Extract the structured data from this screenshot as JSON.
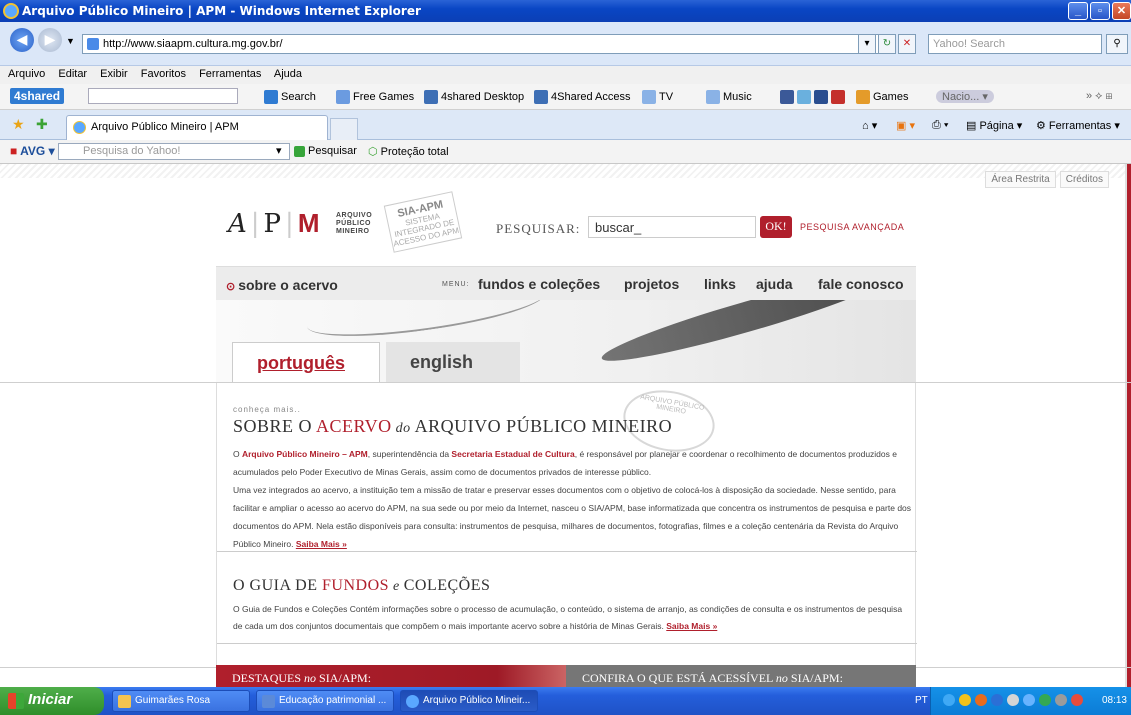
{
  "window": {
    "title": "Arquivo Público Mineiro | APM - Windows Internet Explorer"
  },
  "address": {
    "url": "http://www.siaapm.cultura.mg.gov.br/",
    "search_placeholder": "Yahoo! Search"
  },
  "menubar": {
    "items": [
      "Arquivo",
      "Editar",
      "Exibir",
      "Favoritos",
      "Ferramentas",
      "Ajuda"
    ]
  },
  "toolbar_4shared": {
    "logo": "4shared",
    "search_label": "Search",
    "items": [
      "Free Games",
      "4shared Desktop",
      "4Shared Access",
      "TV",
      "Music",
      "Games"
    ],
    "radio_label": "Nacio..."
  },
  "tabs": {
    "active": "Arquivo Público Mineiro | APM",
    "cmd_page": "Página",
    "cmd_tools": "Ferramentas"
  },
  "avg": {
    "logo": "AVG",
    "search_placeholder": "Pesquisa do Yahoo!",
    "search_btn": "Pesquisar",
    "protection": "Proteção total"
  },
  "site": {
    "toplinks": [
      "Área Restrita",
      "Créditos"
    ],
    "logo_text": [
      "ARQUIVO",
      "PÚBLICO",
      "MINEIRO"
    ],
    "sia_logo": {
      "title": "SIA-APM",
      "sub": "SISTEMA INTEGRADO DE ACESSO DO APM"
    },
    "search_label": "PESQUISAR:",
    "search_value": "buscar_",
    "ok_label": "OK!",
    "advanced": "PESQUISA AVANÇADA",
    "nav": {
      "sobre": "sobre o acervo",
      "menu_label": "MENU:",
      "links": [
        "fundos e coleções",
        "projetos",
        "links",
        "ajuda",
        "fale conosco"
      ]
    },
    "lang": {
      "pt": "português",
      "en": "english"
    },
    "conheca": "conheça mais..",
    "sobre_title": {
      "p1": "SOBRE O ",
      "p2": "ACERVO",
      "p3": " do ",
      "p4": "ARQUIVO PÚBLICO MINEIRO"
    },
    "stamp": "ARQUIVO PÚBLICO MINEIRO",
    "sobre_text": {
      "t1": "O ",
      "b1": "Arquivo Público Mineiro – APM",
      "t2": ", superintendência da ",
      "b2": "Secretaria Estadual de Cultura",
      "t3": ", é responsável por planejar e coordenar o recolhimento de documentos produzidos e acumulados pelo Poder Executivo de Minas Gerais, assim como de documentos privados de interesse público.",
      "t4": "Uma vez integrados ao acervo, a instituição tem a missão de tratar e preservar esses documentos com o objetivo de colocá-los à disposição da sociedade. Nesse sentido, para facilitar e ampliar o acesso ao acervo do APM, na sua sede ou por meio da Internet, nasceu o SIA/APM, base informatizada que concentra os instrumentos de pesquisa e parte dos documentos do APM. Nela estão disponíveis para consulta: instrumentos de pesquisa, milhares de documentos, fotografias, filmes e a coleção centenária da Revista do Arquivo Público Mineiro. ",
      "more": "Saiba Mais »"
    },
    "guia_title": {
      "p1": "O GUIA DE ",
      "p2": "FUNDOS",
      "p3": " e ",
      "p4": "COLEÇÕES"
    },
    "guia_text": {
      "t1": "O Guia de Fundos e Coleções Contém informações sobre o processo de acumulação, o conteúdo, o sistema de arranjo, as condições de consulta e os instrumentos de pesquisa de cada um dos conjuntos documentais que compõem o mais importante acervo sobre a história de Minas Gerais. ",
      "more": "Saiba Mais »"
    },
    "destaques": {
      "p1": "DESTAQUES ",
      "p2": "no",
      "p3": " SIA/APM:"
    },
    "confira": {
      "p1": "CONFIRA O QUE ESTÁ ACESSÍVEL ",
      "p2": "no",
      "p3": " SIA/APM:"
    }
  },
  "taskbar": {
    "start": "Iniciar",
    "tasks": [
      "Guimarães Rosa",
      "Educação patrimonial ...",
      "Arquivo Público Mineir..."
    ],
    "lang": "PT",
    "clock": "08:13"
  },
  "colors": {
    "accent": "#b01f2c",
    "xp_blue": "#245edb"
  }
}
